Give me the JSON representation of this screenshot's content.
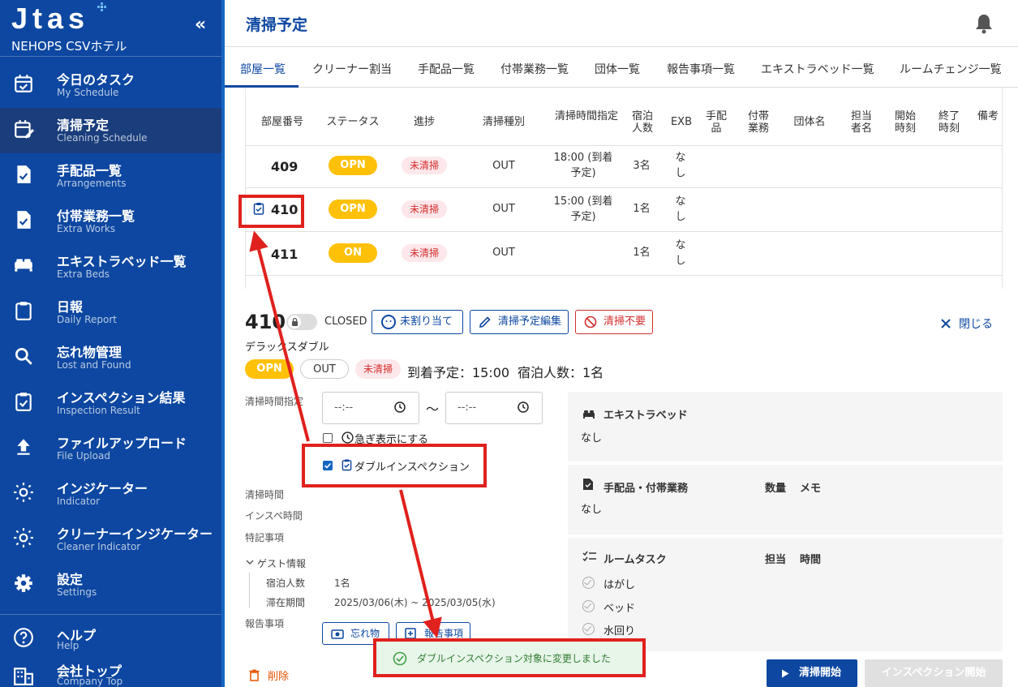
{
  "brand": {
    "logo": "Jtas",
    "hotel": "NEHOPS CSVホテル",
    "collapse": "«"
  },
  "nav": [
    {
      "title": "今日のタスク",
      "sub": "My Schedule",
      "icon": "calendar-check-icon"
    },
    {
      "title": "清掃予定",
      "sub": "Cleaning Schedule",
      "icon": "calendar-edit-icon",
      "active": true
    },
    {
      "title": "手配品一覧",
      "sub": "Arrangements",
      "icon": "document-check-icon"
    },
    {
      "title": "付帯業務一覧",
      "sub": "Extra Works",
      "icon": "document-check-icon"
    },
    {
      "title": "エキストラベッド一覧",
      "sub": "Extra Beds",
      "icon": "bed-icon"
    },
    {
      "title": "日報",
      "sub": "Daily Report",
      "icon": "clipboard-icon"
    },
    {
      "title": "忘れ物管理",
      "sub": "Lost and Found",
      "icon": "search-icon"
    },
    {
      "title": "インスペクション結果",
      "sub": "Inspection Result",
      "icon": "clipboard-check-icon"
    },
    {
      "title": "ファイルアップロード",
      "sub": "File Upload",
      "icon": "upload-icon"
    },
    {
      "title": "インジケーター",
      "sub": "Indicator",
      "icon": "sun-icon"
    },
    {
      "title": "クリーナーインジケーター",
      "sub": "Cleaner Indicator",
      "icon": "sun-icon"
    },
    {
      "title": "設定",
      "sub": "Settings",
      "icon": "gear-icon"
    }
  ],
  "nav_bottom": [
    {
      "title": "ヘルプ",
      "sub": "Help",
      "icon": "help-icon"
    },
    {
      "title": "会社トップ",
      "sub": "Company Top",
      "icon": "building-icon"
    }
  ],
  "header": {
    "title": "清掃予定"
  },
  "tabs": [
    "部屋一覧",
    "クリーナー割当",
    "手配品一覧",
    "付帯業務一覧",
    "団体一覧",
    "報告事項一覧",
    "エキストラベッド一覧",
    "ルームチェンジ一覧"
  ],
  "table": {
    "headers": [
      "部屋番号",
      "ステータス",
      "進捗",
      "清掃種別",
      "清掃時間指定",
      "宿泊人数",
      "EXB",
      "手配品",
      "付帯業務",
      "団体名",
      "担当者名",
      "開始時刻",
      "終了時刻",
      "備考"
    ],
    "rows": [
      {
        "room": "409",
        "status": "OPN",
        "progress": "未清掃",
        "type": "OUT",
        "time": "18:00 (到着予定)",
        "guests": "3名",
        "exb": "なし"
      },
      {
        "room": "410",
        "status": "OPN",
        "progress": "未清掃",
        "type": "OUT",
        "time": "15:00 (到着予定)",
        "guests": "1名",
        "exb": "なし"
      },
      {
        "room": "411",
        "status": "ON",
        "progress": "未清掃",
        "type": "OUT",
        "time": "",
        "guests": "1名",
        "exb": "なし"
      }
    ]
  },
  "detail": {
    "room": "410",
    "closed": "CLOSED",
    "btn_unassigned": "未割り当て",
    "btn_edit": "清掃予定編集",
    "btn_nocleaning": "清掃不要",
    "close": "閉じる",
    "room_type": "デラックスダブル",
    "status": "OPN",
    "type": "OUT",
    "progress": "未清掃",
    "arrival": "到着予定：15:00",
    "guests": "宿泊人数：1名",
    "time_label": "清掃時間指定",
    "time_placeholder": "--:--",
    "tilde": "〜",
    "urgent_label": "急ぎ表示にする",
    "double_insp_label": "ダブルインスペクション",
    "cleaning_time": "清掃時間",
    "insp_time": "インスペ時間",
    "notes": "特記事項",
    "guest_info": "ゲスト情報",
    "guest_count_label": "宿泊人数",
    "guest_count": "1名",
    "stay_label": "滞在期間",
    "stay": "2025/03/06(木) ~ 2025/03/05(水)",
    "report_label": "報告事項",
    "lost_btn": "忘れ物",
    "report_btn": "報告事項",
    "delete": "削除",
    "start": "清掃開始",
    "inspection": "インスペクション開始"
  },
  "panels": {
    "extra_bed_title": "エキストラベッド",
    "extra_bed_value": "なし",
    "arrange_title": "手配品・付帯業務",
    "arrange_qty": "数量",
    "arrange_memo": "メモ",
    "arrange_value": "なし",
    "roomtask_title": "ルームタスク",
    "roomtask_assignee": "担当",
    "roomtask_time": "時間",
    "tasks": [
      "はがし",
      "ベッド",
      "水回り"
    ]
  },
  "toast": {
    "text": "ダブルインスペクション対象に変更しました"
  },
  "colors": {
    "primary": "#0d47a1",
    "status_yellow": "#ffc107",
    "danger": "#d32f2f",
    "annotation": "#e0211d"
  }
}
